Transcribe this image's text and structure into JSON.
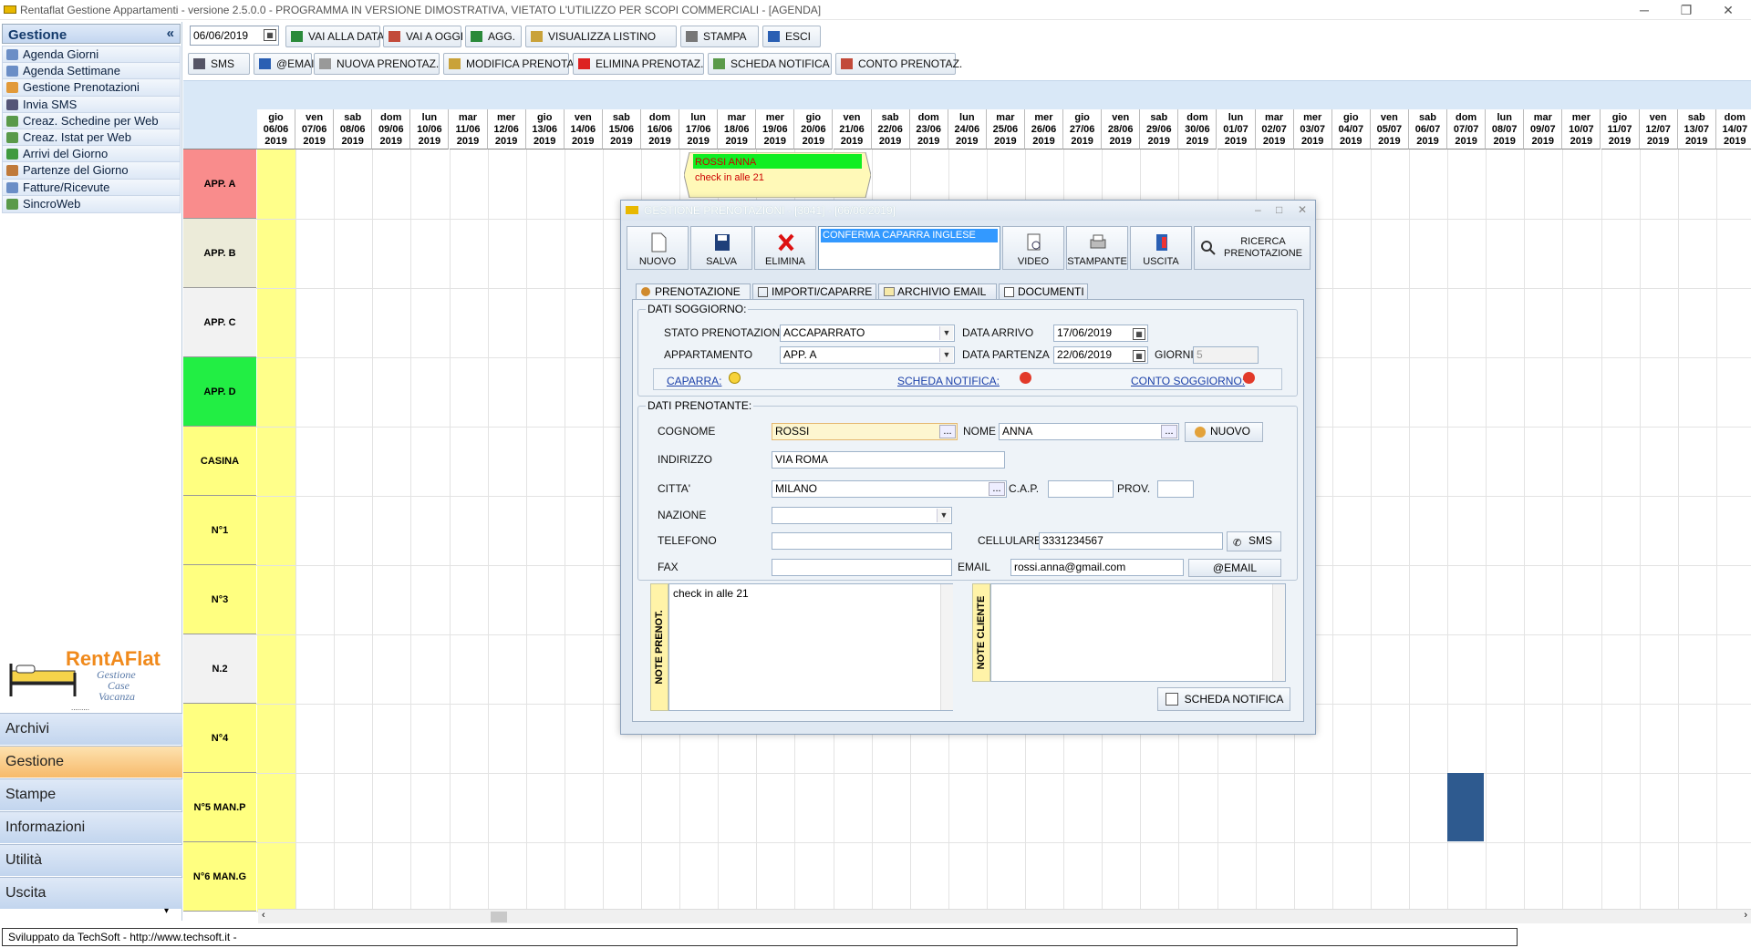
{
  "window": {
    "title": "Rentaflat Gestione Appartamenti - versione 2.5.0.0 - PROGRAMMA IN VERSIONE DIMOSTRATIVA, VIETATO L'UTILIZZO PER SCOPI COMMERCIALI - [AGENDA]",
    "minimize": "─",
    "restore": "❐",
    "close": "✕"
  },
  "sidebar": {
    "header": "Gestione",
    "collapse": "«",
    "items": [
      {
        "label": "Agenda Giorni"
      },
      {
        "label": "Agenda Settimane"
      },
      {
        "label": "Gestione Prenotazioni"
      },
      {
        "label": "Invia SMS"
      },
      {
        "label": "Creaz. Schedine per Web"
      },
      {
        "label": "Creaz. Istat per Web"
      },
      {
        "label": "Arrivi del Giorno"
      },
      {
        "label": "Partenze del Giorno"
      },
      {
        "label": "Fatture/Ricevute"
      },
      {
        "label": "SincroWeb"
      }
    ],
    "logo": {
      "brand": "RentAFlat",
      "line1": "Gestione",
      "line2": "Case",
      "line3": "Vacanza"
    },
    "bottom": [
      {
        "label": "Archivi"
      },
      {
        "label": "Gestione",
        "active": true
      },
      {
        "label": "Stampe"
      },
      {
        "label": "Informazioni"
      },
      {
        "label": "Utilità"
      },
      {
        "label": "Uscita"
      }
    ]
  },
  "toolbar": {
    "date": "06/06/2019",
    "row1": [
      "VAI ALLA DATA",
      "VAI A OGGI",
      "AGG.",
      "VISUALIZZA LISTINO",
      "STAMPA",
      "ESCI"
    ],
    "row2": [
      "SMS",
      "@EMAIL",
      "NUOVA PRENOTAZ.",
      "MODIFICA PRENOTAZ.",
      "ELIMINA PRENOTAZ.",
      "SCHEDA NOTIFICA",
      "CONTO PRENOTAZ."
    ]
  },
  "calendar": {
    "days": [
      [
        "gio",
        "06/06",
        "2019"
      ],
      [
        "ven",
        "07/06",
        "2019"
      ],
      [
        "sab",
        "08/06",
        "2019"
      ],
      [
        "dom",
        "09/06",
        "2019"
      ],
      [
        "lun",
        "10/06",
        "2019"
      ],
      [
        "mar",
        "11/06",
        "2019"
      ],
      [
        "mer",
        "12/06",
        "2019"
      ],
      [
        "gio",
        "13/06",
        "2019"
      ],
      [
        "ven",
        "14/06",
        "2019"
      ],
      [
        "sab",
        "15/06",
        "2019"
      ],
      [
        "dom",
        "16/06",
        "2019"
      ],
      [
        "lun",
        "17/06",
        "2019"
      ],
      [
        "mar",
        "18/06",
        "2019"
      ],
      [
        "mer",
        "19/06",
        "2019"
      ],
      [
        "gio",
        "20/06",
        "2019"
      ],
      [
        "ven",
        "21/06",
        "2019"
      ],
      [
        "sab",
        "22/06",
        "2019"
      ],
      [
        "dom",
        "23/06",
        "2019"
      ],
      [
        "lun",
        "24/06",
        "2019"
      ],
      [
        "mar",
        "25/06",
        "2019"
      ],
      [
        "mer",
        "26/06",
        "2019"
      ],
      [
        "gio",
        "27/06",
        "2019"
      ],
      [
        "ven",
        "28/06",
        "2019"
      ],
      [
        "sab",
        "29/06",
        "2019"
      ],
      [
        "dom",
        "30/06",
        "2019"
      ],
      [
        "lun",
        "01/07",
        "2019"
      ],
      [
        "mar",
        "02/07",
        "2019"
      ],
      [
        "mer",
        "03/07",
        "2019"
      ],
      [
        "gio",
        "04/07",
        "2019"
      ],
      [
        "ven",
        "05/07",
        "2019"
      ],
      [
        "sab",
        "06/07",
        "2019"
      ],
      [
        "dom",
        "07/07",
        "2019"
      ],
      [
        "lun",
        "08/07",
        "2019"
      ],
      [
        "mar",
        "09/07",
        "2019"
      ],
      [
        "mer",
        "10/07",
        "2019"
      ],
      [
        "gio",
        "11/07",
        "2019"
      ],
      [
        "ven",
        "12/07",
        "2019"
      ],
      [
        "sab",
        "13/07",
        "2019"
      ],
      [
        "dom",
        "14/07",
        "2019"
      ]
    ],
    "rooms": [
      {
        "name": "APP. A",
        "color": "#f98c8c"
      },
      {
        "name": "APP. B",
        "color": "#ecebd9"
      },
      {
        "name": "APP. C",
        "color": "#f2f2f2"
      },
      {
        "name": "APP. D",
        "color": "#22ee44"
      },
      {
        "name": "CASINA",
        "color": "#ffff80"
      },
      {
        "name": "N°1",
        "color": "#ffff80"
      },
      {
        "name": "N°3",
        "color": "#ffff80"
      },
      {
        "name": "N.2",
        "color": "#f2f2f2"
      },
      {
        "name": "N°4",
        "color": "#ffff80"
      },
      {
        "name": "N°5 MAN.P",
        "color": "#ffff80"
      },
      {
        "name": "N°6 MAN.G",
        "color": "#ffff80"
      }
    ],
    "booking": {
      "name": "ROSSI ANNA",
      "note": "check in alle 21"
    }
  },
  "status": {
    "text": "Sviluppato da TechSoft - http://www.techsoft.it -"
  },
  "dialog": {
    "title": "GESTIONE PRENOTAZIONI - [3041] - [06/06/2019]",
    "buttons": {
      "nuovo": "NUOVO",
      "salva": "SALVA",
      "elimina": "ELIMINA",
      "video": "VIDEO",
      "stampante": "STAMPANTE",
      "uscita": "USCITA",
      "ricerca1": "RICERCA",
      "ricerca2": "PRENOTAZIONE"
    },
    "list_selected": "CONFERMA CAPARRA INGLESE",
    "tabs": [
      "PRENOTAZIONE",
      "IMPORTI/CAPARRE",
      "ARCHIVIO EMAIL",
      "DOCUMENTI"
    ],
    "soggiorno": {
      "group": "DATI SOGGIORNO:",
      "stato_label": "STATO PRENOTAZIONE",
      "stato": "ACCAPARRATO",
      "app_label": "APPARTAMENTO",
      "app": "APP. A",
      "arrivo_label": "DATA ARRIVO",
      "arrivo": "17/06/2019",
      "partenza_label": "DATA PARTENZA",
      "partenza": "22/06/2019",
      "giorni_label": "GIORNI",
      "giorni": "5",
      "caparra": "CAPARRA:",
      "scheda": "SCHEDA NOTIFICA:",
      "conto": "CONTO SOGGIORNO:"
    },
    "prenotante": {
      "group": "DATI PRENOTANTE:",
      "cognome_label": "COGNOME",
      "cognome": "ROSSI",
      "nome_label": "NOME",
      "nome": "ANNA",
      "nuovo": "NUOVO",
      "indirizzo_label": "INDIRIZZO",
      "indirizzo": "VIA ROMA",
      "citta_label": "CITTA'",
      "citta": "MILANO",
      "cap_label": "C.A.P.",
      "cap": "",
      "prov_label": "PROV.",
      "prov": "",
      "nazione_label": "NAZIONE",
      "nazione": "",
      "telefono_label": "TELEFONO",
      "telefono": "",
      "cellulare_label": "CELLULARE",
      "cellulare": "3331234567",
      "sms": "SMS",
      "fax_label": "FAX",
      "fax": "",
      "email_label": "EMAIL",
      "email": "rossi.anna@gmail.com",
      "email_btn": "@EMAIL"
    },
    "note_prenot_label": "NOTE PRENOT.",
    "note_prenot": "check in alle 21",
    "note_cliente_label": "NOTE CLIENTE",
    "note_cliente": "",
    "scheda_btn": "SCHEDA NOTIFICA"
  }
}
